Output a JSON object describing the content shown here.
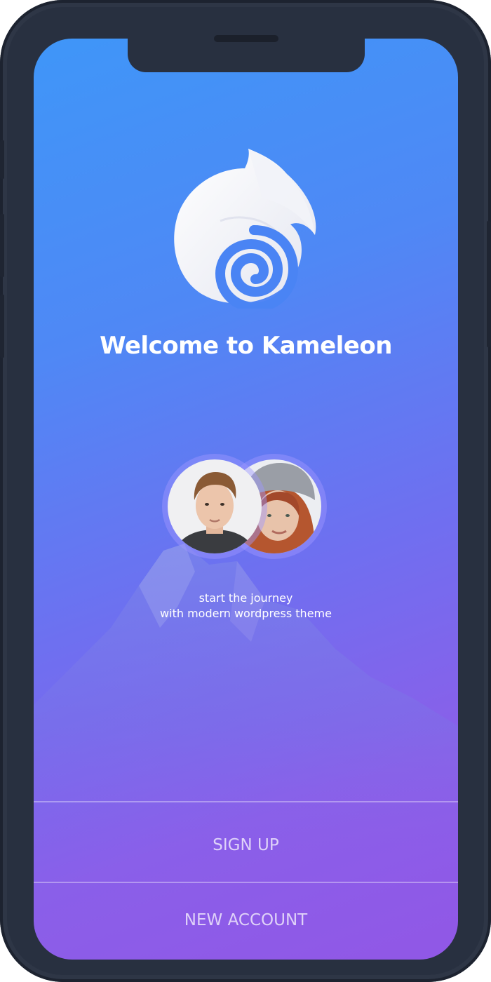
{
  "brand": {
    "welcome_title": "Welcome to Kameleon",
    "logo_icon": "kameleon-logo-icon"
  },
  "avatars": [
    {
      "icon": "user-avatar-man"
    },
    {
      "icon": "user-avatar-woman"
    }
  ],
  "tagline": {
    "line1": "start the journey",
    "line2": "with modern wordpress theme"
  },
  "actions": {
    "sign_up_label": "SIGN UP",
    "new_account_label": "NEW ACCOUNT"
  },
  "colors": {
    "gradient_start": "#3f96f8",
    "gradient_end": "#9157e6",
    "device_frame": "#283040",
    "text": "#ffffff"
  }
}
